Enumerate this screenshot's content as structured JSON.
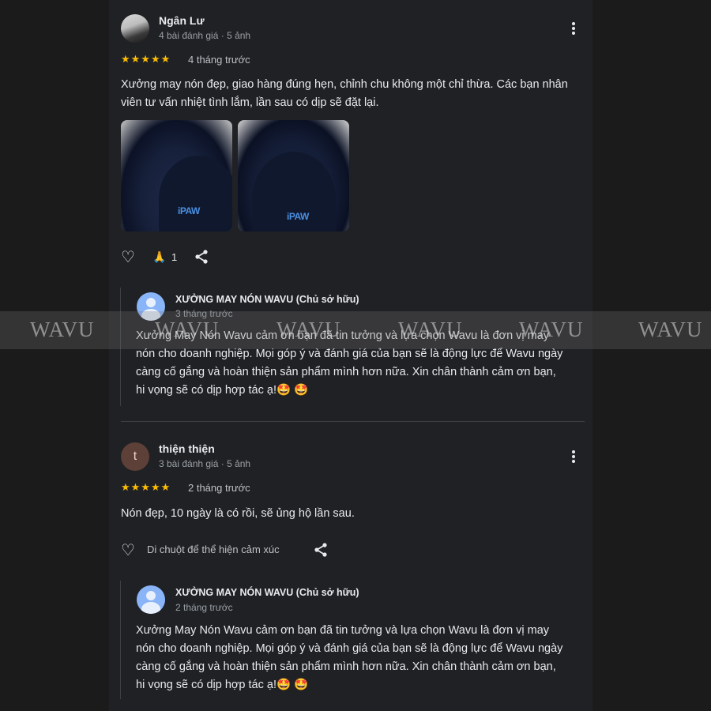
{
  "reviews": [
    {
      "author": "Ngân Lư",
      "meta": "4 bài đánh giá · 5 ảnh",
      "stars": "★★★★★",
      "time": "4 tháng trước",
      "text": "Xưởng may nón đẹp, giao hàng đúng hẹn, chỉnh chu không một chỉ thừa. Các bạn nhân viên tư vấn nhiệt tình lắm, lần sau có dịp sẽ đặt lại.",
      "photo_logo_1": "iPAW",
      "photo_logo_2": "iPAW",
      "reaction_emoji": "🙏",
      "reaction_count": "1",
      "owner_reply": {
        "name": "XƯỞNG MAY NÓN WAVU (Chủ sở hữu)",
        "time": "3 tháng trước",
        "text": "Xưởng May Nón Wavu cảm ơn bạn đã tin tưởng và lựa chọn Wavu là đơn vị may nón cho doanh nghiệp. Mọi góp ý và đánh giá của bạn sẽ là động lực để Wavu ngày càng cố gắng và hoàn thiện sản phẩm mình hơn nữa. Xin chân thành cảm ơn bạn, hi vọng sẽ có dịp hợp tác ạ!🤩 🤩"
      }
    },
    {
      "author": "thiện thiện",
      "avatar_letter": "t",
      "meta": "3 bài đánh giá · 5 ảnh",
      "stars": "★★★★★",
      "time": "2 tháng trước",
      "text": "Nón đẹp, 10 ngày là có rồi, sẽ ủng hộ lần sau.",
      "hover_hint": "Di chuột để thể hiện cảm xúc",
      "owner_reply": {
        "name": "XƯỞNG MAY NÓN WAVU (Chủ sở hữu)",
        "time": "2 tháng trước",
        "text": "Xưởng May Nón Wavu cảm ơn bạn đã tin tưởng và lựa chọn Wavu là đơn vị may nón cho doanh nghiệp. Mọi góp ý và đánh giá của bạn sẽ là động lực để Wavu ngày càng cố gắng và hoàn thiện sản phẩm mình hơn nữa. Xin chân thành cảm ơn bạn, hi vọng sẽ có dịp hợp tác ạ!🤩 🤩"
      }
    }
  ],
  "icons": {
    "heart": "♡",
    "share": "share-icon",
    "more": "more-vert-icon"
  },
  "watermark": "WAVU",
  "colors": {
    "background": "#202124",
    "side": "#1b1b1c",
    "star": "#fbbc04",
    "owner_avatar": "#8ab4f8"
  }
}
